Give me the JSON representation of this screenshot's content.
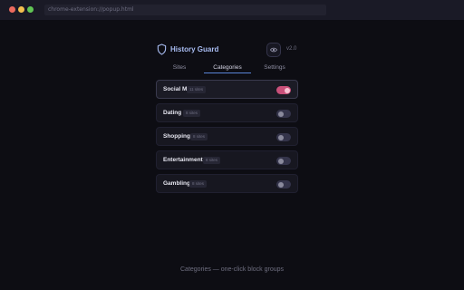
{
  "browser": {
    "url": "chrome-extension://popup.html"
  },
  "header": {
    "title": "History Guard",
    "version": "v2.0",
    "shield_icon": "shield-icon",
    "eye_icon": "eye-icon"
  },
  "tabs": [
    {
      "label": "Sites"
    },
    {
      "label": "Categories",
      "active": true
    },
    {
      "label": "Settings"
    }
  ],
  "categories": [
    {
      "name": "Social Media",
      "count": "11 sites",
      "enabled": true
    },
    {
      "name": "Dating",
      "count": "8 sites",
      "enabled": false
    },
    {
      "name": "Shopping",
      "count": "8 sites",
      "enabled": false
    },
    {
      "name": "Entertainment",
      "count": "8 sites",
      "enabled": false
    },
    {
      "name": "Gambling",
      "count": "8 sites",
      "enabled": false
    }
  ],
  "caption": "Categories — one-click block groups",
  "colors": {
    "accent": "#a8bcf2",
    "toggle_on": "#c9507a",
    "background": "#0d0d13"
  }
}
